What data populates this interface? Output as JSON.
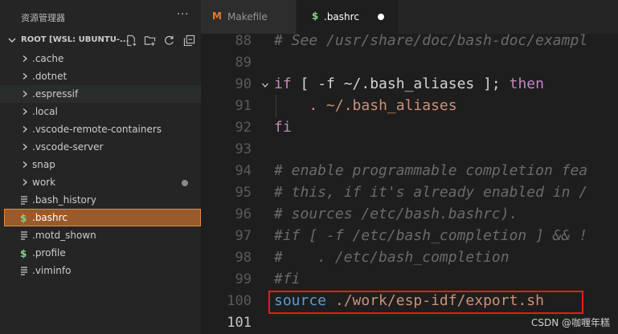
{
  "sidebar": {
    "title": "资源管理器",
    "more_label": "···",
    "root_label": "ROOT [WSL: UBUNTU-...",
    "actions": [
      "new-file",
      "new-folder",
      "refresh",
      "collapse-all"
    ],
    "items": [
      {
        "label": ".cache",
        "type": "folder"
      },
      {
        "label": ".dotnet",
        "type": "folder"
      },
      {
        "label": ".espressif",
        "type": "folder"
      },
      {
        "label": ".local",
        "type": "folder"
      },
      {
        "label": ".vscode-remote-containers",
        "type": "folder"
      },
      {
        "label": ".vscode-server",
        "type": "folder"
      },
      {
        "label": "snap",
        "type": "folder"
      },
      {
        "label": "work",
        "type": "folder",
        "modified": true
      },
      {
        "label": ".bash_history",
        "type": "file"
      },
      {
        "label": ".bashrc",
        "type": "file",
        "selected": true
      },
      {
        "label": ".motd_shown",
        "type": "file"
      },
      {
        "label": ".profile",
        "type": "file"
      },
      {
        "label": ".viminfo",
        "type": "file"
      }
    ]
  },
  "tabs": [
    {
      "label": "Makefile",
      "icon_glyph": "M",
      "icon": "makefile-icon",
      "active": false
    },
    {
      "label": ".bashrc",
      "icon_glyph": "$",
      "icon": "shell-icon",
      "active": true,
      "dirty": true
    }
  ],
  "editor": {
    "lines": [
      {
        "num": "88",
        "text": "# See /usr/share/doc/bash-doc/exampl"
      },
      {
        "num": "89",
        "text": ""
      },
      {
        "num": "90",
        "kw1": "if",
        "mid": " [ -f ~/.bash_aliases ]; ",
        "kw2": "then"
      },
      {
        "num": "91",
        "indent": "    ",
        "dot": ". ",
        "path": "~/.bash_aliases"
      },
      {
        "num": "92",
        "text": "fi"
      },
      {
        "num": "93",
        "text": ""
      },
      {
        "num": "94",
        "text": "# enable programmable completion fea"
      },
      {
        "num": "95",
        "text": "# this, if it's already enabled in /"
      },
      {
        "num": "96",
        "text": "# sources /etc/bash.bashrc)."
      },
      {
        "num": "97",
        "text": "#if [ -f /etc/bash_completion ] && !"
      },
      {
        "num": "98",
        "text": "#    . /etc/bash_completion"
      },
      {
        "num": "99",
        "text": "#fi"
      },
      {
        "num": "100",
        "src_kw": "source",
        "src_path": " ./work/esp-idf/export.sh"
      },
      {
        "num": "101",
        "text": ""
      }
    ]
  },
  "watermark": "CSDN @咖喱年糕",
  "colors": {
    "accent_selection": "#9a5a2a",
    "highlight_border": "#e01e1e",
    "keyword": "#c586c0",
    "comment": "#6a6a6a",
    "string_path": "#ce9178"
  }
}
